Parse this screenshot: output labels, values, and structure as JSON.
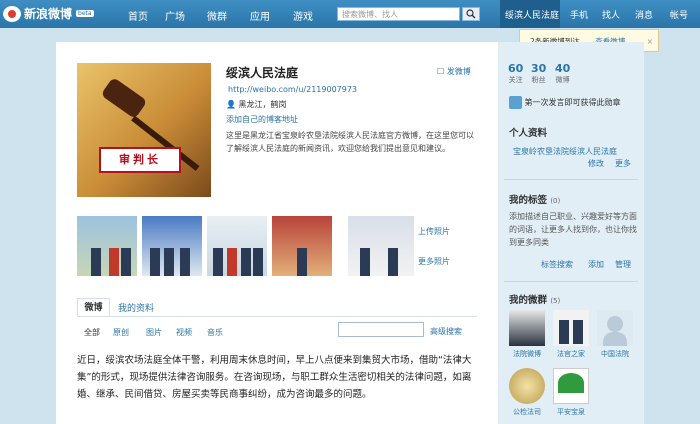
{
  "nav": {
    "logo": "新浪微博",
    "beta": "beta",
    "items": [
      "首页",
      "广场",
      "微群",
      "应用",
      "游戏"
    ],
    "search_placeholder": "搜索微博、找人",
    "right": [
      "绥滨人民法庭",
      "手机",
      "找人",
      "消息",
      "帐号"
    ]
  },
  "popup": {
    "text": "2条新微博到达，",
    "link": "查看微博",
    "close": "×"
  },
  "profile": {
    "name": "绥滨人民法庭",
    "send": "发微博",
    "url": "http://weibo.com/u/2119007973",
    "location": "黑龙江，鹤岗",
    "add_blog": "添加自己的博客地址",
    "bio": "这里是黑龙江省宝泉岭农垦法院绥滨人民法庭官方微博，在这里您可以了解绥滨人民法庭的新闻资讯，欢迎您给我们提出意见和建议。",
    "avatar_text": "审判长"
  },
  "photos": {
    "upload": "上传照片",
    "more": "更多照片"
  },
  "tabs": [
    "微博",
    "我的资料"
  ],
  "filters": [
    "全部",
    "原创",
    "图片",
    "视频",
    "音乐"
  ],
  "advanced_search": "高级搜索",
  "post": "近日，绥滨农场法庭全体干警，利用周末休息时间，早上八点便来到集贸大市场，借助“法律大集”的形式，现场提供法律咨询服务。在咨询现场，与职工群众生活密切相关的法律问题，如离婚、继承、民间借贷、房屋买卖等民商事纠纷，成为咨询最多的问题。",
  "stats": [
    {
      "num": "60",
      "label": "关注"
    },
    {
      "num": "30",
      "label": "粉丝"
    },
    {
      "num": "40",
      "label": "微博"
    }
  ],
  "badge_text": "第一次发言即可获得此勋章",
  "personal": {
    "title": "个人资料",
    "org": "宝泉岭农垦法院绥滨人民法庭",
    "edit": "修改",
    "more": "更多"
  },
  "tags": {
    "title": "我的标签",
    "count": "(0)",
    "text": "添加描述自己职业、兴趣爱好等方面的词语，让更多人找到你，也让你找到更多同类",
    "actions": [
      "标签搜索",
      "添加",
      "管理"
    ]
  },
  "favs": {
    "title": "我的微群",
    "count": "(5)",
    "items": [
      "法院微博",
      "法官之家",
      "中国法院",
      "公检法司",
      "平安宝泉"
    ]
  },
  "colors": {
    "nav": "#2a74a8",
    "link": "#2a74a8",
    "bg": "#cfe3ef"
  }
}
